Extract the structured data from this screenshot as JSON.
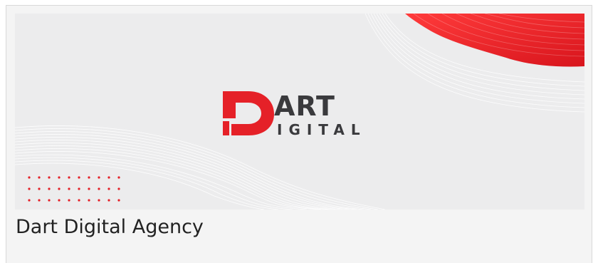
{
  "card": {
    "title": "Dart Digital Agency"
  },
  "banner": {
    "logo": {
      "line1": "DART",
      "line2": "IGITAL"
    },
    "colors": {
      "background": "#ececed",
      "accent": "#e52128",
      "logo_dark": "#3a3a3d",
      "wave_lines": "#ffffff"
    }
  }
}
